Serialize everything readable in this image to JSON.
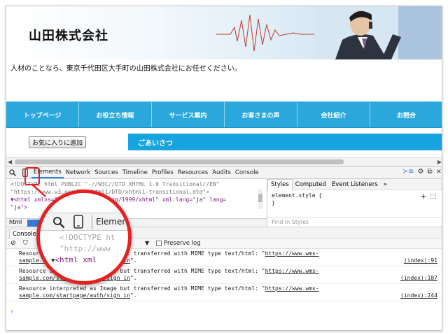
{
  "site": {
    "title": "山田株式会社",
    "tagline": "人材のことなら、東京千代田区大手町の山田株式会社にお任せください。",
    "nav": [
      "トップページ",
      "お役立ち情報",
      "サービス案内",
      "お客さまの声",
      "会社紹介",
      "お問合"
    ],
    "favorite_button": "お気に入りに追加",
    "greeting": "ごあいさつ"
  },
  "devtools": {
    "tabs": [
      "Elements",
      "Network",
      "Sources",
      "Timeline",
      "Profiles",
      "Resources",
      "Audits",
      "Console"
    ],
    "active_tab": "Elements",
    "elements_lines": [
      "<!DOCTYPE html PUBLIC \"-//W3C//DTD XHTML 1.0 Transitional//EN\"",
      "\"https://www.w3.org/TR/xhtml1/DTD/xhtml1-transitional.dtd\">",
      "▼<html xmlns=\"https://www.w3.org/1999/xhtml\" xml:lang=\"ja\" lang=",
      "\"ja\">"
    ],
    "breadcrumb": "html",
    "styles_tabs": [
      "Styles",
      "Computed",
      "Event Listeners",
      "»"
    ],
    "style_rule_open": "element.style {",
    "style_rule_close": "}",
    "find_placeholder": "Find in Styles",
    "console_tab": "Console",
    "console_filter": "▼",
    "preserve_log": "Preserve log",
    "messages": [
      {
        "prefix": "Resource interpreted as Image but transferred with MIME type text/html: \"",
        "link": "https://www.wms-",
        "line2": "sample.com/startpage/auth/sign_in",
        "suffix": "\".",
        "source": "(index):91"
      },
      {
        "prefix": "Resource interpreted as Image but transferred with MIME type text/html: \"",
        "link": "https://www.wms-",
        "line2": "sample.com/startpage/auth/sign_in",
        "suffix": "\".",
        "source": "(index):187"
      },
      {
        "prefix": "Resource interpreted as Image but transferred with MIME type text/html: \"",
        "link": "https://www.wms-",
        "line2": "sample.com/startpage/auth/sign_in",
        "suffix": "\".",
        "source": "(index):244"
      }
    ],
    "prompt": "›"
  },
  "magnifier": {
    "label": "Elemen",
    "code_line1": "<!DOCTYPE ht",
    "code_line2": "\"http://www",
    "code_line3_tag": "<html xml",
    "code_line3_tri": "▼"
  },
  "icons": {
    "search": "search-icon",
    "device": "device-mode-icon",
    "gear": "gear-icon",
    "dock": "dock-icon",
    "close": "close-icon"
  },
  "colors": {
    "nav_blue": "#2aa8dd",
    "greeting_blue": "#17a3df",
    "highlight_red": "#e52222",
    "devtools_active": "#3879d9"
  }
}
